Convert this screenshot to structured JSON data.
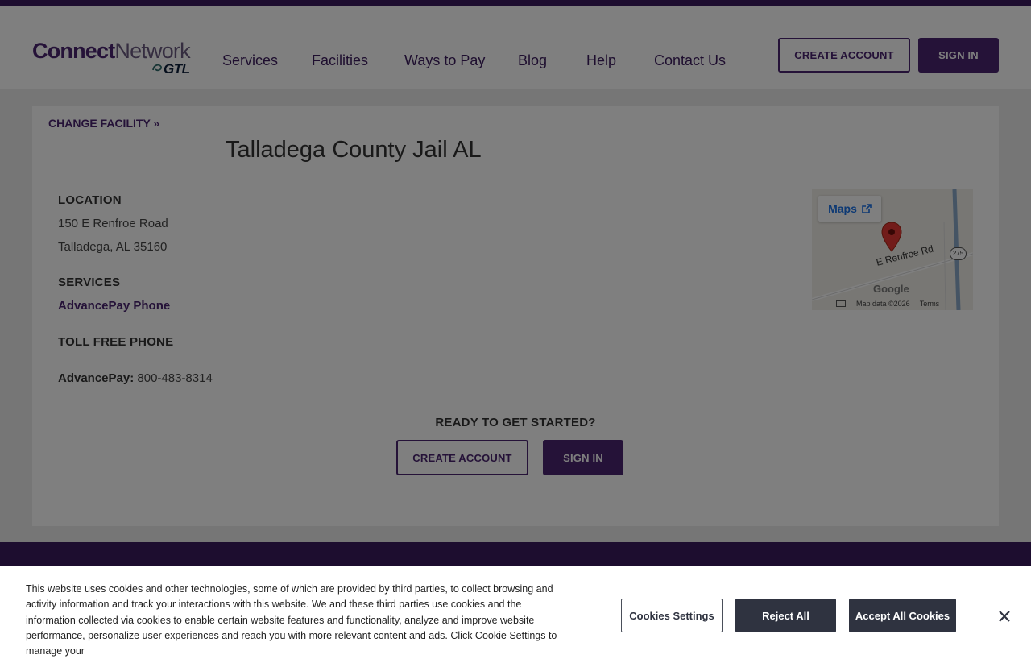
{
  "header": {
    "logo": {
      "brand_bold": "Connect",
      "brand_light": "Network",
      "sub_brand": "GTL"
    },
    "nav": [
      {
        "label": "Services"
      },
      {
        "label": "Facilities"
      },
      {
        "label": "Ways to Pay"
      },
      {
        "label": "Blog"
      },
      {
        "label": "Help"
      },
      {
        "label": "Contact Us"
      }
    ],
    "create_account_label": "CREATE ACCOUNT",
    "sign_in_label": "SIGN IN"
  },
  "facility": {
    "change_facility_label": "CHANGE FACILITY »",
    "title": "Talladega County Jail AL",
    "location_label": "LOCATION",
    "address_line1": "150 E Renfroe Road",
    "address_line2": "Talladega, AL 35160",
    "services_label": "SERVICES",
    "service_link": "AdvancePay Phone",
    "toll_free_label": "TOLL FREE PHONE",
    "phone_label": "AdvancePay:",
    "phone_number": "800-483-8314"
  },
  "map": {
    "maps_button_label": "Maps",
    "road_label": "E Renfroe Rd",
    "route_shield": "275",
    "google_label": "Google",
    "map_data_label": "Map data ©2026",
    "terms_label": "Terms",
    "icons": [
      "external-link-icon",
      "map-marker-icon",
      "keyboard-icon"
    ]
  },
  "cta": {
    "ready_label": "READY TO GET STARTED?",
    "create_account_label": "CREATE ACCOUNT",
    "sign_in_label": "SIGN IN"
  },
  "cookie_banner": {
    "text": "This website uses cookies and other technologies, some of which are provided by third parties, to collect browsing and activity information and track your interactions with this website. We and these third parties use cookies and the information collected via cookies to enable certain website features and functionality, analyze and improve website performance, personalize user experiences and reach you with more relevant content and ads. Click Cookie Settings to manage your",
    "settings_label": "Cookies Settings",
    "reject_label": "Reject All",
    "accept_label": "Accept All Cookies"
  },
  "colors": {
    "brand_purple": "#4a2470",
    "top_bar": "#3a1a5e",
    "cookie_button_dark": "#2f3340"
  }
}
